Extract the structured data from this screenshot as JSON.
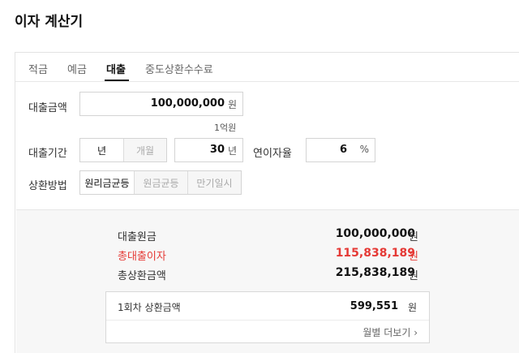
{
  "page": {
    "title": "이자 계산기"
  },
  "tabs": [
    {
      "label": "적금",
      "active": false
    },
    {
      "label": "예금",
      "active": false
    },
    {
      "label": "대출",
      "active": true
    },
    {
      "label": "중도상환수수료",
      "active": false
    }
  ],
  "loan_amount": {
    "label": "대출금액",
    "value": "100,000,000",
    "unit": "원",
    "caption": "1억원"
  },
  "loan_period": {
    "label": "대출기간",
    "unit_options": [
      "년",
      "개월"
    ],
    "selected_unit": "년",
    "value": "30",
    "unit": "년"
  },
  "interest_rate": {
    "label": "연이자율",
    "value": "6",
    "unit": "%"
  },
  "repayment": {
    "label": "상환방법",
    "options": [
      "원리금균등",
      "원금균등",
      "만기일시"
    ],
    "selected": "원리금균등"
  },
  "results": {
    "principal": {
      "label": "대출원금",
      "value": "100,000,000",
      "unit": "원"
    },
    "total_interest": {
      "label": "총대출이자",
      "value": "115,838,189",
      "unit": "원"
    },
    "total_repayment": {
      "label": "총상환금액",
      "value": "215,838,189",
      "unit": "원"
    },
    "first_payment": {
      "label": "1회차 상환금액",
      "value": "599,551",
      "unit": "원"
    },
    "more_label": "월별 더보기 ›"
  },
  "colors": {
    "accent_red": "#e53935"
  }
}
